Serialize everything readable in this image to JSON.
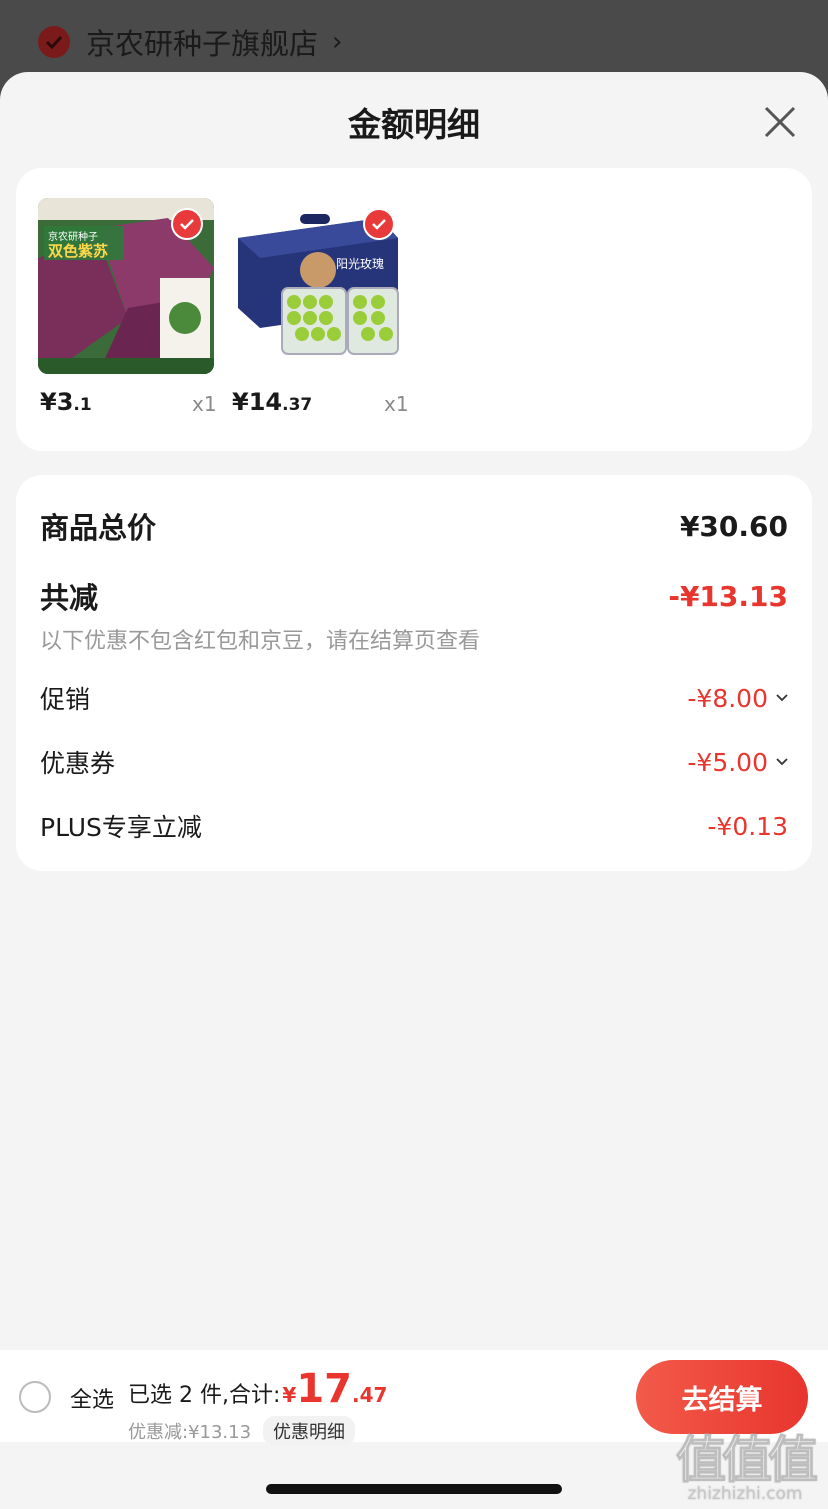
{
  "store": {
    "name": "京农研种子旗舰店",
    "arrow": "›"
  },
  "sheet": {
    "title": "金额明细"
  },
  "items": [
    {
      "price_int": "¥3",
      "price_dec": ".1",
      "qty": "x1",
      "image_icon": "purple-perilla-seed-pack"
    },
    {
      "price_int": "¥14",
      "price_dec": ".37",
      "qty": "x1",
      "image_icon": "green-grape-gift-box"
    }
  ],
  "detail": {
    "total_label": "商品总价",
    "total_value": "¥30.60",
    "reduce_label": "共减",
    "reduce_value": "-¥13.13",
    "note": "以下优惠不包含红包和京豆，请在结算页查看",
    "rows": [
      {
        "label": "促销",
        "value": "-¥8.00"
      },
      {
        "label": "优惠券",
        "value": "-¥5.00"
      },
      {
        "label": "PLUS专享立减",
        "value": "-¥0.13"
      }
    ]
  },
  "bottom": {
    "select_all": "全选",
    "summary_prefix": "已选 2 件,合计:",
    "currency": "¥",
    "total_int": "17",
    "total_dec": ".47",
    "discount": "优惠减:¥13.13",
    "detail_link": "优惠明细",
    "checkout": "去结算"
  },
  "watermark": {
    "big": "值值值",
    "small": "zhizhizhi.com"
  },
  "colors": {
    "accent": "#e8352d",
    "background": "#f4f4f4",
    "card": "#ffffff",
    "muted": "#999999"
  }
}
